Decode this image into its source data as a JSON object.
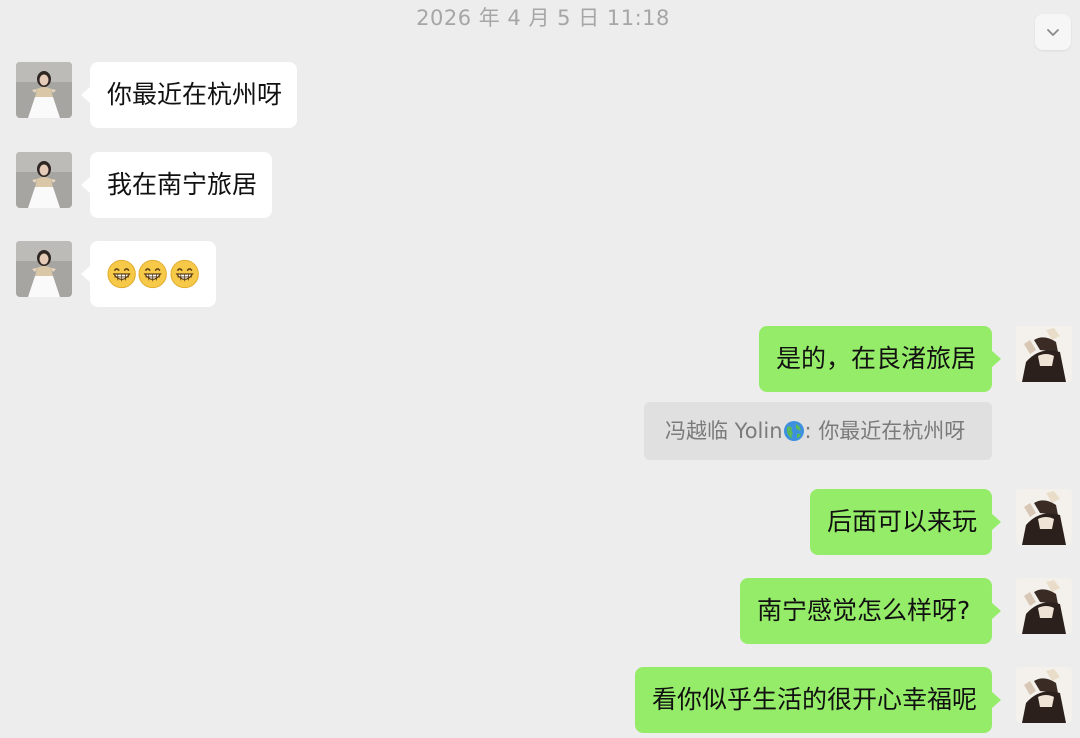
{
  "timestamp": "2026 年 4 月 5 日 11:18",
  "scroll_button": {
    "icon": "chevron-down-icon"
  },
  "contact": {
    "avatar_icon": "contact-avatar-woman-white-dress"
  },
  "self": {
    "avatar_icon": "self-avatar-illustration"
  },
  "messages": [
    {
      "side": "incoming",
      "text": "你最近在杭州呀"
    },
    {
      "side": "incoming",
      "text": "我在南宁旅居"
    },
    {
      "side": "incoming",
      "type": "emoji",
      "emoji_icon": "grinning-face-emoji",
      "count": 3
    },
    {
      "side": "outgoing",
      "text": "是的，在良渚旅居",
      "quote": {
        "sender": "冯越临 Yolin",
        "sender_icon": "globe-emoji",
        "separator": ": ",
        "text": "你最近在杭州呀"
      }
    },
    {
      "side": "outgoing",
      "text": "后面可以来玩"
    },
    {
      "side": "outgoing",
      "text": "南宁感觉怎么样呀?"
    },
    {
      "side": "outgoing",
      "text": "看你似乎生活的很开心幸福呢"
    }
  ],
  "colors": {
    "background": "#ededed",
    "incoming_bubble": "#ffffff",
    "outgoing_bubble": "#95ec69",
    "quote_background": "#e0e0e0",
    "timestamp_text": "#a6a6a6"
  }
}
